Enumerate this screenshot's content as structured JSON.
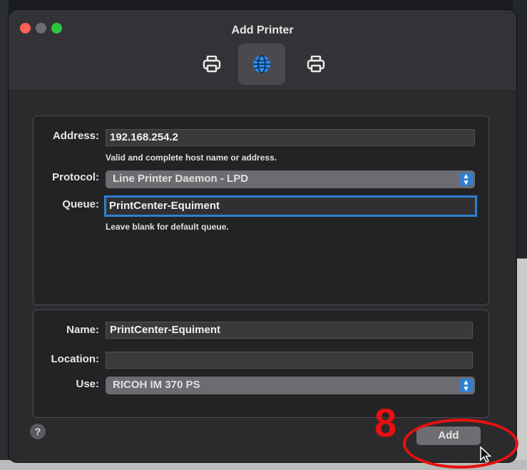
{
  "window": {
    "title": "Add Printer"
  },
  "toolbar": {
    "tabs": [
      {
        "icon": "printer-icon"
      },
      {
        "icon": "globe-icon"
      },
      {
        "icon": "printer-icon"
      }
    ]
  },
  "connection": {
    "address_label": "Address:",
    "address_value": "192.168.254.2",
    "address_hint": "Valid and complete host name or address.",
    "protocol_label": "Protocol:",
    "protocol_value": "Line Printer Daemon - LPD",
    "queue_label": "Queue:",
    "queue_value": "PrintCenter-Equiment",
    "queue_hint": "Leave blank for default queue."
  },
  "details": {
    "name_label": "Name:",
    "name_value": "PrintCenter-Equiment",
    "location_label": "Location:",
    "location_value": "",
    "use_label": "Use:",
    "use_value": "RICOH IM 370 PS"
  },
  "footer": {
    "help_label": "?",
    "add_label": "Add"
  },
  "annotation": {
    "step_number": "8",
    "color": "#e81010"
  },
  "colors": {
    "accent": "#2f7fd0",
    "close": "#fe5f57",
    "zoom": "#2ac840"
  }
}
